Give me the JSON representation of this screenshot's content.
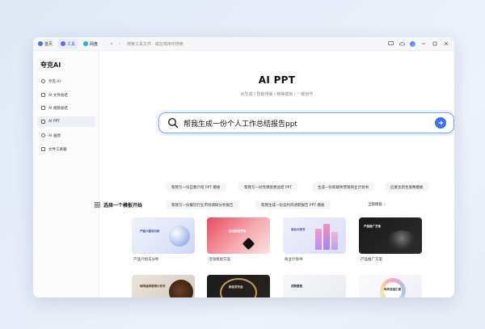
{
  "topbar": {
    "tabs": [
      {
        "label": "首页",
        "icon": "home-icon",
        "color": "#3a7bd5"
      },
      {
        "label": "工具",
        "icon": "tools-icon",
        "color": "#7a5cf0"
      },
      {
        "label": "网盘",
        "icon": "cloud-icon",
        "color": "#2fa7e0"
      }
    ],
    "url_text": "搜索工具文件 · 或在常用中搜索"
  },
  "sidebar": {
    "brand": "夸克AI",
    "items": [
      {
        "label": "夸克 AI",
        "name": "sidebar-item-quark-ai"
      },
      {
        "label": "AI 文件总结",
        "name": "sidebar-item-file-summary"
      },
      {
        "label": "AI 视频总结",
        "name": "sidebar-item-video-summary"
      },
      {
        "label": "AI PPT",
        "name": "sidebar-item-ai-ppt"
      },
      {
        "label": "AI 画图",
        "name": "sidebar-item-ai-drawing"
      },
      {
        "label": "文件工具箱",
        "name": "sidebar-item-file-toolbox"
      }
    ]
  },
  "main": {
    "title": "AI PPT",
    "subtitle": "AI生成 | 智能排版 | 精美模板 | 一键创作",
    "search_query": "帮我生成一份个人工作总结报告ppt",
    "suggestions": [
      "帮我写一份自我介绍 PPT 模板",
      "帮我写一份党课思想总结 PPT",
      "生成一份新媒体营销商业计划书",
      "启蒙生新生策略模板",
      "帮我写一份餐饮行业市场调研分析报告",
      "帮我生成一份竞约风述职报告 PPT 模板"
    ],
    "section_title": "选择一个模板开始",
    "more_label": "全部模板",
    "templates": [
      {
        "label": "产品介绍与分析",
        "thumb_text": "产品介绍与分析"
      },
      {
        "label": "活动策划方案",
        "thumb_text": "活动策划方案"
      },
      {
        "label": "商业计划书",
        "thumb_text": "商业计划书"
      },
      {
        "label": "产品推广方案",
        "thumb_text": "产品推广方案"
      },
      {
        "label": "",
        "thumb_text": "咖啡品牌营销计划书"
      },
      {
        "label": "",
        "thumb_text": "新品发布会"
      },
      {
        "label": "",
        "thumb_text": "述职报告"
      },
      {
        "label": "",
        "thumb_text": "年终总结汇报"
      }
    ]
  },
  "colors": {
    "accent": "#3f6ff0",
    "search_border": "#7aa6f5",
    "sidebar_bg": "#fbfbfc"
  }
}
